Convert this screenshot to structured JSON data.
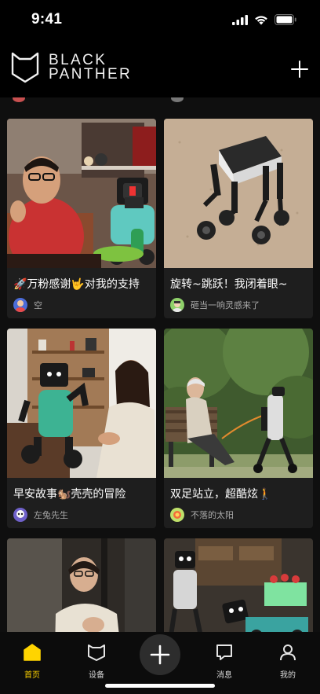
{
  "status_bar": {
    "time": "9:41"
  },
  "header": {
    "brand_line1": "BLACK",
    "brand_line2": "PANTHER"
  },
  "feed": {
    "cards": [
      {
        "title": "🚀万粉感谢🤟对我的支持",
        "author": "空"
      },
      {
        "title": "旋转~跳跃！我闭着眼~",
        "author": "砸当一响灵感来了"
      },
      {
        "title": "早安故事🐿️壳壳的冒险",
        "author": "左兔先生"
      },
      {
        "title": "双足站立，超酷炫🚶",
        "author": "不落的太阳"
      }
    ]
  },
  "bottom_nav": {
    "items": [
      {
        "label": "首页",
        "active": true
      },
      {
        "label": "设备",
        "active": false
      },
      {
        "label": "消息",
        "active": false
      },
      {
        "label": "我的",
        "active": false
      }
    ]
  },
  "colors": {
    "accent": "#ffd400",
    "card": "#1e1e1e",
    "background": "#0f0f0f"
  }
}
